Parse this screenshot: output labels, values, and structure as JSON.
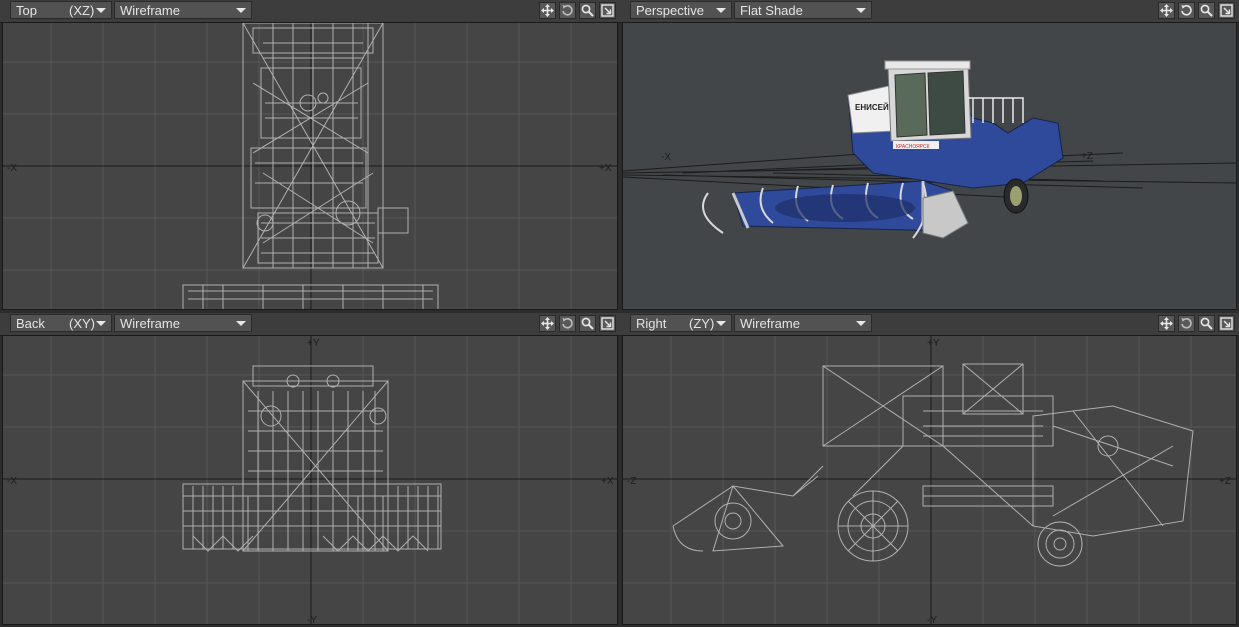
{
  "viewports": [
    {
      "id": "top",
      "view": "Top",
      "axes": "(XZ)",
      "mode": "Wireframe",
      "h_neg": "-X",
      "h_pos": "+X",
      "v_neg": "",
      "v_pos": ""
    },
    {
      "id": "persp",
      "view": "Perspective",
      "axes": "",
      "mode": "Flat Shade",
      "h_neg": "-X",
      "h_pos": "+Z",
      "v_neg": "",
      "v_pos": ""
    },
    {
      "id": "back",
      "view": "Back",
      "axes": "(XY)",
      "mode": "Wireframe",
      "h_neg": "-X",
      "h_pos": "+X",
      "v_neg": "-Y",
      "v_pos": "+Y"
    },
    {
      "id": "right",
      "view": "Right",
      "axes": "(ZY)",
      "mode": "Wireframe",
      "h_neg": "-Z",
      "h_pos": "+Z",
      "v_neg": "-Y",
      "v_pos": "+Y"
    }
  ],
  "tool_icons": [
    "move-icon",
    "rotate-icon",
    "zoom-icon",
    "maximize-icon"
  ],
  "model_decals": {
    "brand": "ЕНИСЕЙ",
    "plate": "КРАСНОЯРСК"
  },
  "colors": {
    "grid": "#575757",
    "axis": "#1c1c1c",
    "wire": "#b0b0b0",
    "body_blue": "#2f4a9a"
  }
}
